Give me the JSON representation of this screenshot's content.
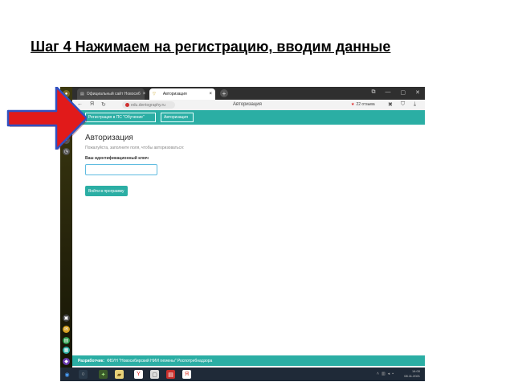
{
  "slide": {
    "title": "Шаг 4 Нажимаем на регистрацию, вводим данные"
  },
  "browser": {
    "tabs": [
      {
        "label": "Официальный сайт Новосиб"
      },
      {
        "label": "Авторизация"
      }
    ],
    "address_text": "edu.dentography.ru",
    "page_title": "Авторизация",
    "reviews_text": "22 отзыва"
  },
  "site_nav": {
    "register_label": "Регистрация в ПС \"Обучение\"",
    "auth_label": "Авторизация"
  },
  "auth_form": {
    "heading": "Авторизация",
    "hint": "Пожалуйста, заполните поля, чтобы авторизоваться:",
    "key_label": "Ваш идентификационный ключ",
    "key_value": "",
    "login_button": "Войти в программу"
  },
  "footer": {
    "prefix": "Разработчик:",
    "text": "ФБУН \"Новосибирский НИИ гигиены\" Роспотребнадзора"
  },
  "taskbar": {
    "time": "14:00",
    "date": "08.11.2021"
  },
  "colors": {
    "teal": "#2baea4",
    "arrow": "#e11a1a"
  }
}
